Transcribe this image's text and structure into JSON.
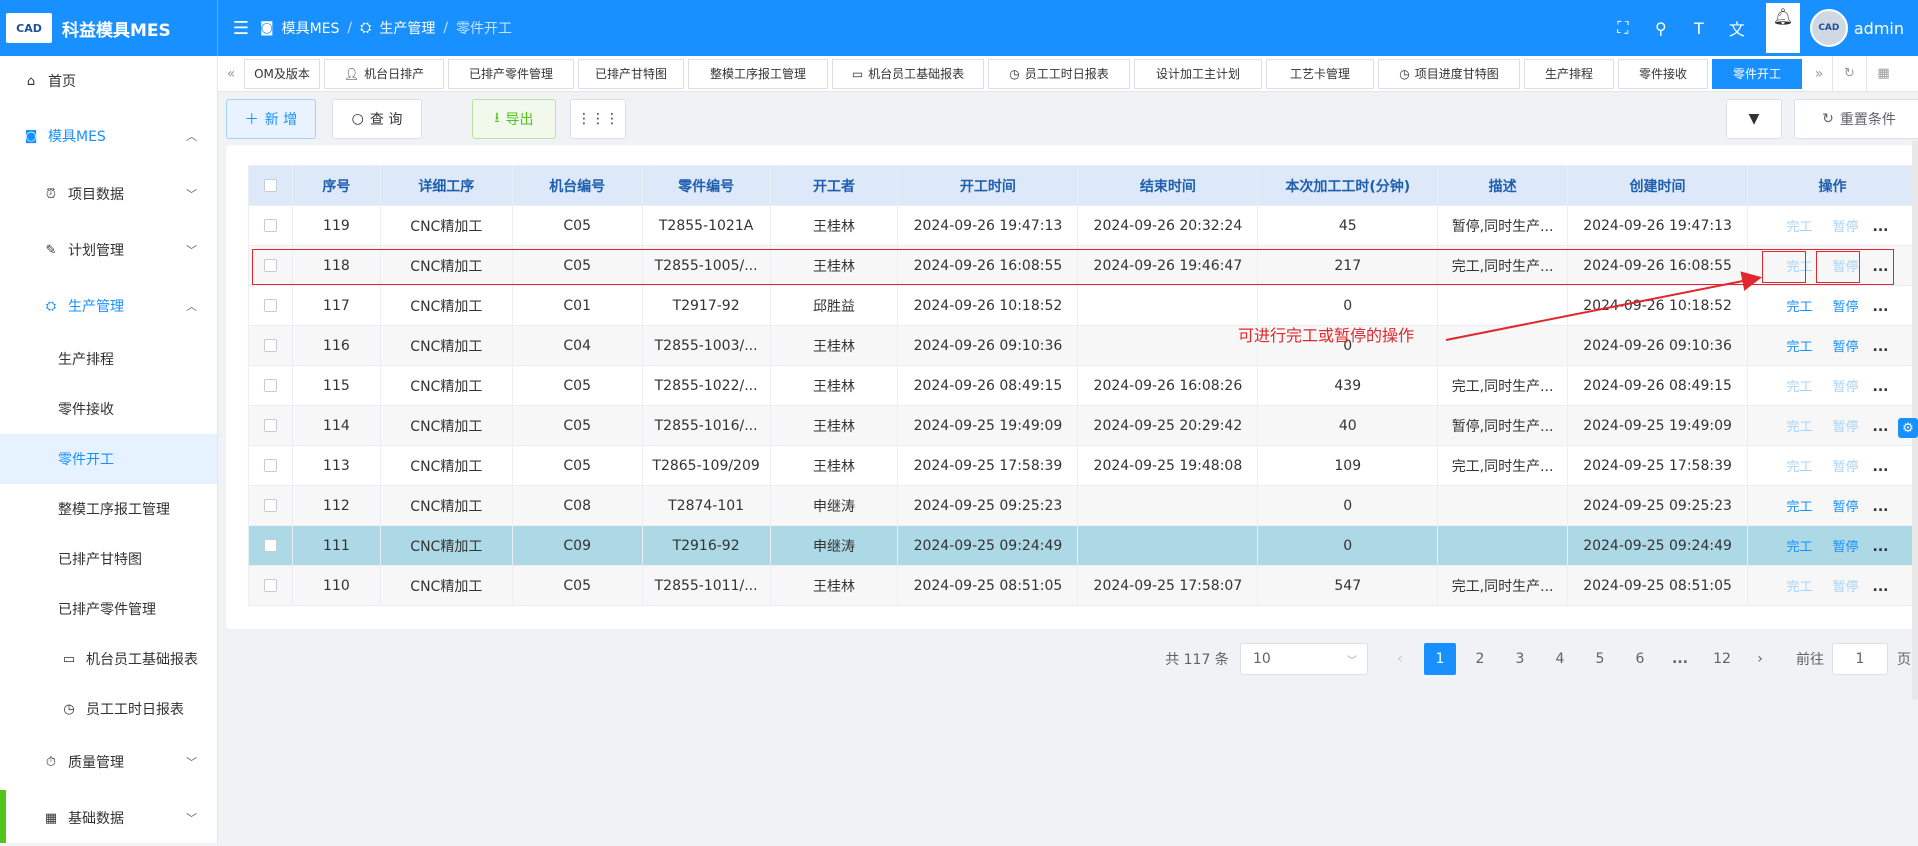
{
  "app": {
    "logo_text": "CAD",
    "title": "科益模具MES"
  },
  "breadcrumb": [
    "模具MES",
    "生产管理",
    "零件开工"
  ],
  "user": {
    "name": "admin",
    "avatar_text": "CAD"
  },
  "sidebar": {
    "items": [
      {
        "label": "首页",
        "icon": "home-icon"
      },
      {
        "label": "模具MES",
        "icon": "camera-icon"
      },
      {
        "label": "项目数据",
        "icon": "alarm-icon"
      },
      {
        "label": "计划管理",
        "icon": "edit-icon"
      },
      {
        "label": "生产管理",
        "icon": "factory-icon"
      },
      {
        "label": "生产排程"
      },
      {
        "label": "零件接收"
      },
      {
        "label": "零件开工"
      },
      {
        "label": "整模工序报工管理"
      },
      {
        "label": "已排产甘特图"
      },
      {
        "label": "已排产零件管理"
      },
      {
        "label": "机台员工基础报表",
        "icon": "report-icon"
      },
      {
        "label": "员工工时日报表",
        "icon": "clock-icon"
      },
      {
        "label": "质量管理",
        "icon": "stopwatch-icon"
      },
      {
        "label": "基础数据",
        "icon": "calendar-icon"
      }
    ]
  },
  "tabs": [
    {
      "label": "OM及版本"
    },
    {
      "label": "机台日排产"
    },
    {
      "label": "已排产零件管理"
    },
    {
      "label": "已排产甘特图"
    },
    {
      "label": "整模工序报工管理"
    },
    {
      "label": "机台员工基础报表"
    },
    {
      "label": "员工工时日报表"
    },
    {
      "label": "设计加工主计划"
    },
    {
      "label": "工艺卡管理"
    },
    {
      "label": "项目进度甘特图"
    },
    {
      "label": "生产排程"
    },
    {
      "label": "零件接收"
    },
    {
      "label": "零件开工"
    }
  ],
  "toolbar": {
    "add": "新 增",
    "query": "查 询",
    "export": "导出",
    "reset": "重置条件"
  },
  "table": {
    "columns": [
      "序号",
      "详细工序",
      "机台编号",
      "零件编号",
      "开工者",
      "开工时间",
      "结束时间",
      "本次加工工时(分钟)",
      "描述",
      "创建时间",
      "操作"
    ],
    "rows": [
      [
        "119",
        "CNC精加工",
        "C05",
        "T2855-1021A",
        "王桂林",
        "2024-09-26 19:47:13",
        "2024-09-26 20:32:24",
        "45",
        "暂停,同时生产...",
        "2024-09-26 19:47:13"
      ],
      [
        "118",
        "CNC精加工",
        "C05",
        "T2855-1005/...",
        "王桂林",
        "2024-09-26 16:08:55",
        "2024-09-26 19:46:47",
        "217",
        "完工,同时生产...",
        "2024-09-26 16:08:55"
      ],
      [
        "117",
        "CNC精加工",
        "C01",
        "T2917-92",
        "邱胜益",
        "2024-09-26 10:18:52",
        "",
        "0",
        "",
        "2024-09-26 10:18:52"
      ],
      [
        "116",
        "CNC精加工",
        "C04",
        "T2855-1003/...",
        "王桂林",
        "2024-09-26 09:10:36",
        "",
        "0",
        "",
        "2024-09-26 09:10:36"
      ],
      [
        "115",
        "CNC精加工",
        "C05",
        "T2855-1022/...",
        "王桂林",
        "2024-09-26 08:49:15",
        "2024-09-26 16:08:26",
        "439",
        "完工,同时生产...",
        "2024-09-26 08:49:15"
      ],
      [
        "114",
        "CNC精加工",
        "C05",
        "T2855-1016/...",
        "王桂林",
        "2024-09-25 19:49:09",
        "2024-09-25 20:29:42",
        "40",
        "暂停,同时生产...",
        "2024-09-25 19:49:09"
      ],
      [
        "113",
        "CNC精加工",
        "C05",
        "T2865-109/209",
        "王桂林",
        "2024-09-25 17:58:39",
        "2024-09-25 19:48:08",
        "109",
        "完工,同时生产...",
        "2024-09-25 17:58:39"
      ],
      [
        "112",
        "CNC精加工",
        "C08",
        "T2874-101",
        "申继涛",
        "2024-09-25 09:25:23",
        "",
        "0",
        "",
        "2024-09-25 09:25:23"
      ],
      [
        "111",
        "CNC精加工",
        "C09",
        "T2916-92",
        "申继涛",
        "2024-09-25 09:24:49",
        "",
        "0",
        "",
        "2024-09-25 09:24:49"
      ],
      [
        "110",
        "CNC精加工",
        "C05",
        "T2855-1011/...",
        "王桂林",
        "2024-09-25 08:51:05",
        "2024-09-25 17:58:07",
        "547",
        "完工,同时生产...",
        "2024-09-25 08:51:05"
      ]
    ],
    "dim_rows": [
      0,
      1,
      4,
      5,
      6,
      9
    ],
    "selected_row": 8,
    "actions": {
      "done": "完工",
      "pause": "暂停",
      "more": "..."
    }
  },
  "annotation": "可进行完工或暂停的操作",
  "pagination": {
    "total": "共 117 条",
    "page_size": "10",
    "pages": [
      "1",
      "2",
      "3",
      "4",
      "5",
      "6",
      "...",
      "12"
    ],
    "current": "1",
    "goto_label": "前往",
    "goto_value": "1",
    "page_unit": "页"
  }
}
